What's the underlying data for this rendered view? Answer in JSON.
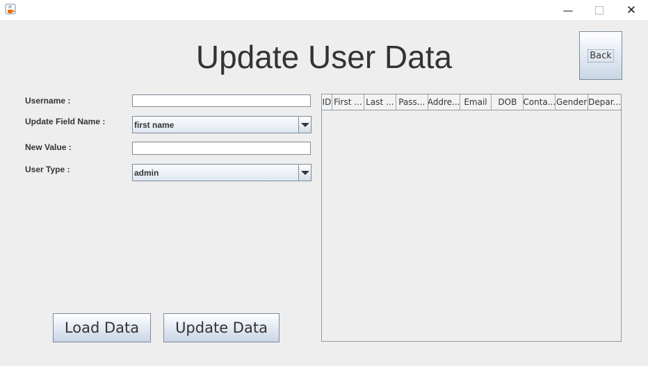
{
  "window": {
    "app_icon": "java-coffee-icon",
    "minimize": "—",
    "close": "✕"
  },
  "page": {
    "title": "Update User Data",
    "back_label": "Back"
  },
  "form": {
    "username_label": "Username :",
    "username_value": "",
    "field_name_label": "Update Field Name :",
    "field_name_value": "first name",
    "new_value_label": "New Value :",
    "new_value_value": "",
    "user_type_label": "User Type :",
    "user_type_value": "admin"
  },
  "actions": {
    "load_label": "Load Data",
    "update_label": "Update Data"
  },
  "table": {
    "columns": [
      "ID",
      "First ...",
      "Last ...",
      "Pass...",
      "Addre...",
      "Email",
      "DOB",
      "Conta...",
      "Gender",
      "Depar..."
    ],
    "rows": []
  }
}
